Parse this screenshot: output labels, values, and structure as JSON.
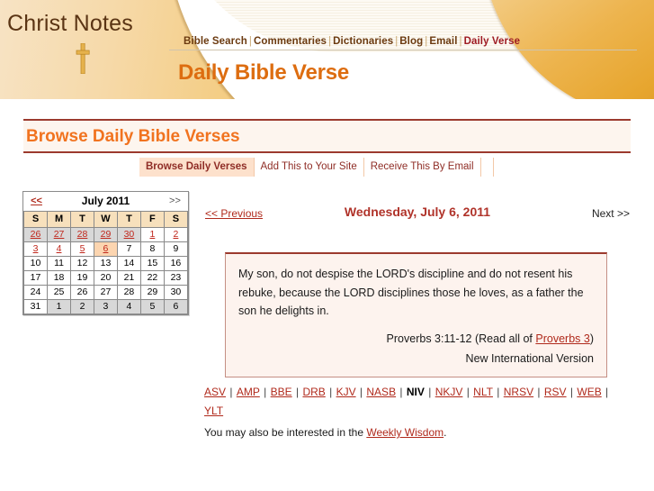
{
  "site": {
    "logo_text": "Christ Notes",
    "logo_icon": "cross-icon"
  },
  "nav": {
    "items": [
      {
        "label": "Bible Search",
        "current": false
      },
      {
        "label": "Commentaries",
        "current": false
      },
      {
        "label": "Dictionaries",
        "current": false
      },
      {
        "label": "Blog",
        "current": false
      },
      {
        "label": "Email",
        "current": false
      },
      {
        "label": "Daily Verse",
        "current": true
      }
    ],
    "separator": "|"
  },
  "page_title": "Daily Bible Verse",
  "section": {
    "heading": "Browse Daily Bible Verses"
  },
  "tabs": [
    {
      "label": "Browse Daily Verses",
      "active": true
    },
    {
      "label": "Add This to Your Site",
      "active": false
    },
    {
      "label": "Receive This By Email",
      "active": false
    }
  ],
  "calendar": {
    "prev_label": "<<",
    "next_label": ">>",
    "month_label": "July 2011",
    "dow": [
      "S",
      "M",
      "T",
      "W",
      "T",
      "F",
      "S"
    ],
    "weeks": [
      [
        {
          "d": "26",
          "type": "other-link"
        },
        {
          "d": "27",
          "type": "other-link"
        },
        {
          "d": "28",
          "type": "other-link"
        },
        {
          "d": "29",
          "type": "other-link"
        },
        {
          "d": "30",
          "type": "other-link"
        },
        {
          "d": "1",
          "type": "link"
        },
        {
          "d": "2",
          "type": "link"
        }
      ],
      [
        {
          "d": "3",
          "type": "link"
        },
        {
          "d": "4",
          "type": "link"
        },
        {
          "d": "5",
          "type": "link"
        },
        {
          "d": "6",
          "type": "today-link"
        },
        {
          "d": "7",
          "type": "plain"
        },
        {
          "d": "8",
          "type": "plain"
        },
        {
          "d": "9",
          "type": "plain"
        }
      ],
      [
        {
          "d": "10",
          "type": "plain"
        },
        {
          "d": "11",
          "type": "plain"
        },
        {
          "d": "12",
          "type": "plain"
        },
        {
          "d": "13",
          "type": "plain"
        },
        {
          "d": "14",
          "type": "plain"
        },
        {
          "d": "15",
          "type": "plain"
        },
        {
          "d": "16",
          "type": "plain"
        }
      ],
      [
        {
          "d": "17",
          "type": "plain"
        },
        {
          "d": "18",
          "type": "plain"
        },
        {
          "d": "19",
          "type": "plain"
        },
        {
          "d": "20",
          "type": "plain"
        },
        {
          "d": "21",
          "type": "plain"
        },
        {
          "d": "22",
          "type": "plain"
        },
        {
          "d": "23",
          "type": "plain"
        }
      ],
      [
        {
          "d": "24",
          "type": "plain"
        },
        {
          "d": "25",
          "type": "plain"
        },
        {
          "d": "26",
          "type": "plain"
        },
        {
          "d": "27",
          "type": "plain"
        },
        {
          "d": "28",
          "type": "plain"
        },
        {
          "d": "29",
          "type": "plain"
        },
        {
          "d": "30",
          "type": "plain"
        }
      ],
      [
        {
          "d": "31",
          "type": "plain"
        },
        {
          "d": "1",
          "type": "other"
        },
        {
          "d": "2",
          "type": "other"
        },
        {
          "d": "3",
          "type": "other"
        },
        {
          "d": "4",
          "type": "other"
        },
        {
          "d": "5",
          "type": "other"
        },
        {
          "d": "6",
          "type": "other"
        }
      ]
    ]
  },
  "verse": {
    "prev_label": "<< Previous",
    "date_label": "Wednesday, July 6, 2011",
    "next_label": "Next >>",
    "text": "My son, do not despise the LORD's discipline and do not resent his rebuke, because the LORD disciplines those he loves, as a father the son he delights in.",
    "reference_prefix": "Proverbs 3:11-12 (Read all of ",
    "reference_link": "Proverbs 3",
    "reference_suffix": ")",
    "version": "New International Version"
  },
  "translations": {
    "items": [
      {
        "label": "ASV",
        "current": false
      },
      {
        "label": "AMP",
        "current": false
      },
      {
        "label": "BBE",
        "current": false
      },
      {
        "label": "DRB",
        "current": false
      },
      {
        "label": "KJV",
        "current": false
      },
      {
        "label": "NASB",
        "current": false
      },
      {
        "label": "NIV",
        "current": true
      },
      {
        "label": "NKJV",
        "current": false
      },
      {
        "label": "NLT",
        "current": false
      },
      {
        "label": "NRSV",
        "current": false
      },
      {
        "label": "RSV",
        "current": false
      },
      {
        "label": "WEB",
        "current": false
      },
      {
        "label": "YLT",
        "current": false
      }
    ],
    "separator": "|"
  },
  "footnote": {
    "prefix": "You may also be interested in the ",
    "link": "Weekly Wisdom",
    "suffix": "."
  },
  "colors": {
    "brand_orange": "#dd6d10",
    "accent_maroon": "#9c3a2e",
    "link_red": "#b02a1c",
    "header_gold": "#eeb94f",
    "tab_active_bg": "#fde1cc",
    "today_bg": "#fcd5b0"
  }
}
